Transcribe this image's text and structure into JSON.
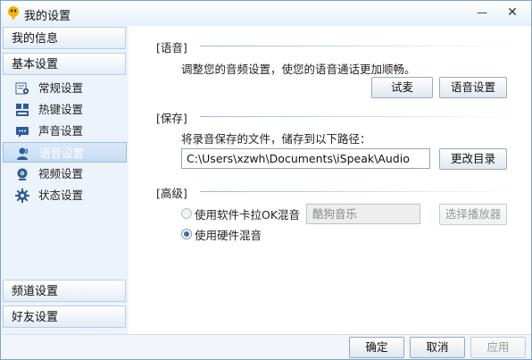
{
  "window": {
    "title": "我的设置",
    "minimize_glyph": "—",
    "close_glyph": "✕"
  },
  "sidebar": {
    "headers": {
      "my_info": "我的信息",
      "basic": "基本设置",
      "channel": "频道设置",
      "friends": "好友设置"
    },
    "items": [
      {
        "label": "常规设置",
        "icon": "general-settings-icon"
      },
      {
        "label": "热键设置",
        "icon": "hotkey-icon"
      },
      {
        "label": "声音设置",
        "icon": "sound-icon"
      },
      {
        "label": "语音设置",
        "icon": "voice-icon",
        "active": true
      },
      {
        "label": "视频设置",
        "icon": "video-icon"
      },
      {
        "label": "状态设置",
        "icon": "gear-icon"
      }
    ]
  },
  "voice_section": {
    "title": "[语音]",
    "description": "调整您的音频设置，使您的语音通话更加顺畅。",
    "test_button": "试麦",
    "voice_settings_button": "语音设置"
  },
  "save_section": {
    "title": "[保存]",
    "description": "将录音保存的文件，储存到以下路径：",
    "path": "C:\\Users\\xzwh\\Documents\\iSpeak\\Audio",
    "change_dir_button": "更改目录"
  },
  "advanced_section": {
    "title": "[高级]",
    "software_mix_label": "使用软件卡拉OK混音",
    "software_mix_selected": false,
    "software_mix_enabled": false,
    "player_value": "酷狗音乐",
    "choose_player_button": "选择播放器",
    "hardware_mix_label": "使用硬件混音",
    "hardware_mix_selected": true
  },
  "footer": {
    "ok": "确定",
    "cancel": "取消",
    "apply": "应用"
  },
  "colors": {
    "accent": "#2f6fc8",
    "sidebar_bg": "#edf3fa",
    "border": "#7aa6d8"
  }
}
